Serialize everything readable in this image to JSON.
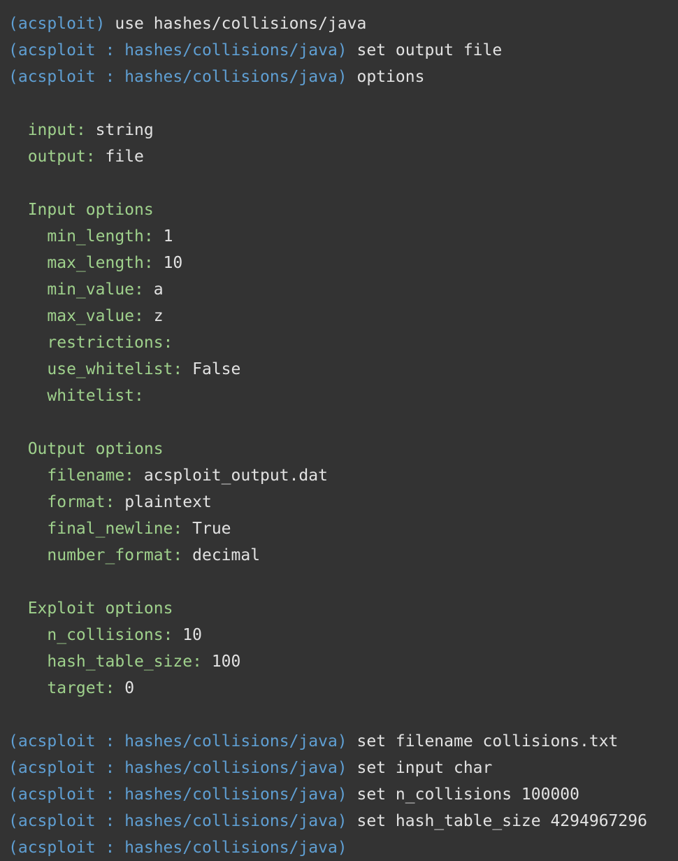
{
  "colors": {
    "background": "#333333",
    "prompt": "#5f9fd3",
    "key": "#9fd18c",
    "text": "#e2e2e2"
  },
  "lines": [
    {
      "type": "prompt",
      "prompt": "(acsploit)",
      "cmd": "use hashes/collisions/java"
    },
    {
      "type": "prompt",
      "prompt": "(acsploit : hashes/collisions/java)",
      "cmd": "set output file"
    },
    {
      "type": "prompt",
      "prompt": "(acsploit : hashes/collisions/java)",
      "cmd": "options"
    },
    {
      "type": "blank"
    },
    {
      "type": "kv",
      "indent": 2,
      "key": "input:",
      "value": "string"
    },
    {
      "type": "kv",
      "indent": 2,
      "key": "output:",
      "value": "file"
    },
    {
      "type": "blank"
    },
    {
      "type": "heading",
      "indent": 2,
      "text": "Input options"
    },
    {
      "type": "kv",
      "indent": 4,
      "key": "min_length:",
      "value": "1"
    },
    {
      "type": "kv",
      "indent": 4,
      "key": "max_length:",
      "value": "10"
    },
    {
      "type": "kv",
      "indent": 4,
      "key": "min_value:",
      "value": "a"
    },
    {
      "type": "kv",
      "indent": 4,
      "key": "max_value:",
      "value": "z"
    },
    {
      "type": "kv",
      "indent": 4,
      "key": "restrictions:",
      "value": ""
    },
    {
      "type": "kv",
      "indent": 4,
      "key": "use_whitelist:",
      "value": "False"
    },
    {
      "type": "kv",
      "indent": 4,
      "key": "whitelist:",
      "value": ""
    },
    {
      "type": "blank"
    },
    {
      "type": "heading",
      "indent": 2,
      "text": "Output options"
    },
    {
      "type": "kv",
      "indent": 4,
      "key": "filename:",
      "value": "acsploit_output.dat"
    },
    {
      "type": "kv",
      "indent": 4,
      "key": "format:",
      "value": "plaintext"
    },
    {
      "type": "kv",
      "indent": 4,
      "key": "final_newline:",
      "value": "True"
    },
    {
      "type": "kv",
      "indent": 4,
      "key": "number_format:",
      "value": "decimal"
    },
    {
      "type": "blank"
    },
    {
      "type": "heading",
      "indent": 2,
      "text": "Exploit options"
    },
    {
      "type": "kv",
      "indent": 4,
      "key": "n_collisions:",
      "value": "10"
    },
    {
      "type": "kv",
      "indent": 4,
      "key": "hash_table_size:",
      "value": "100"
    },
    {
      "type": "kv",
      "indent": 4,
      "key": "target:",
      "value": "0"
    },
    {
      "type": "blank"
    },
    {
      "type": "prompt",
      "prompt": "(acsploit : hashes/collisions/java)",
      "cmd": "set filename collisions.txt"
    },
    {
      "type": "prompt",
      "prompt": "(acsploit : hashes/collisions/java)",
      "cmd": "set input char"
    },
    {
      "type": "prompt",
      "prompt": "(acsploit : hashes/collisions/java)",
      "cmd": "set n_collisions 100000"
    },
    {
      "type": "prompt",
      "prompt": "(acsploit : hashes/collisions/java)",
      "cmd": "set hash_table_size 4294967296"
    },
    {
      "type": "prompt",
      "prompt": "(acsploit : hashes/collisions/java)",
      "cmd": ""
    }
  ]
}
